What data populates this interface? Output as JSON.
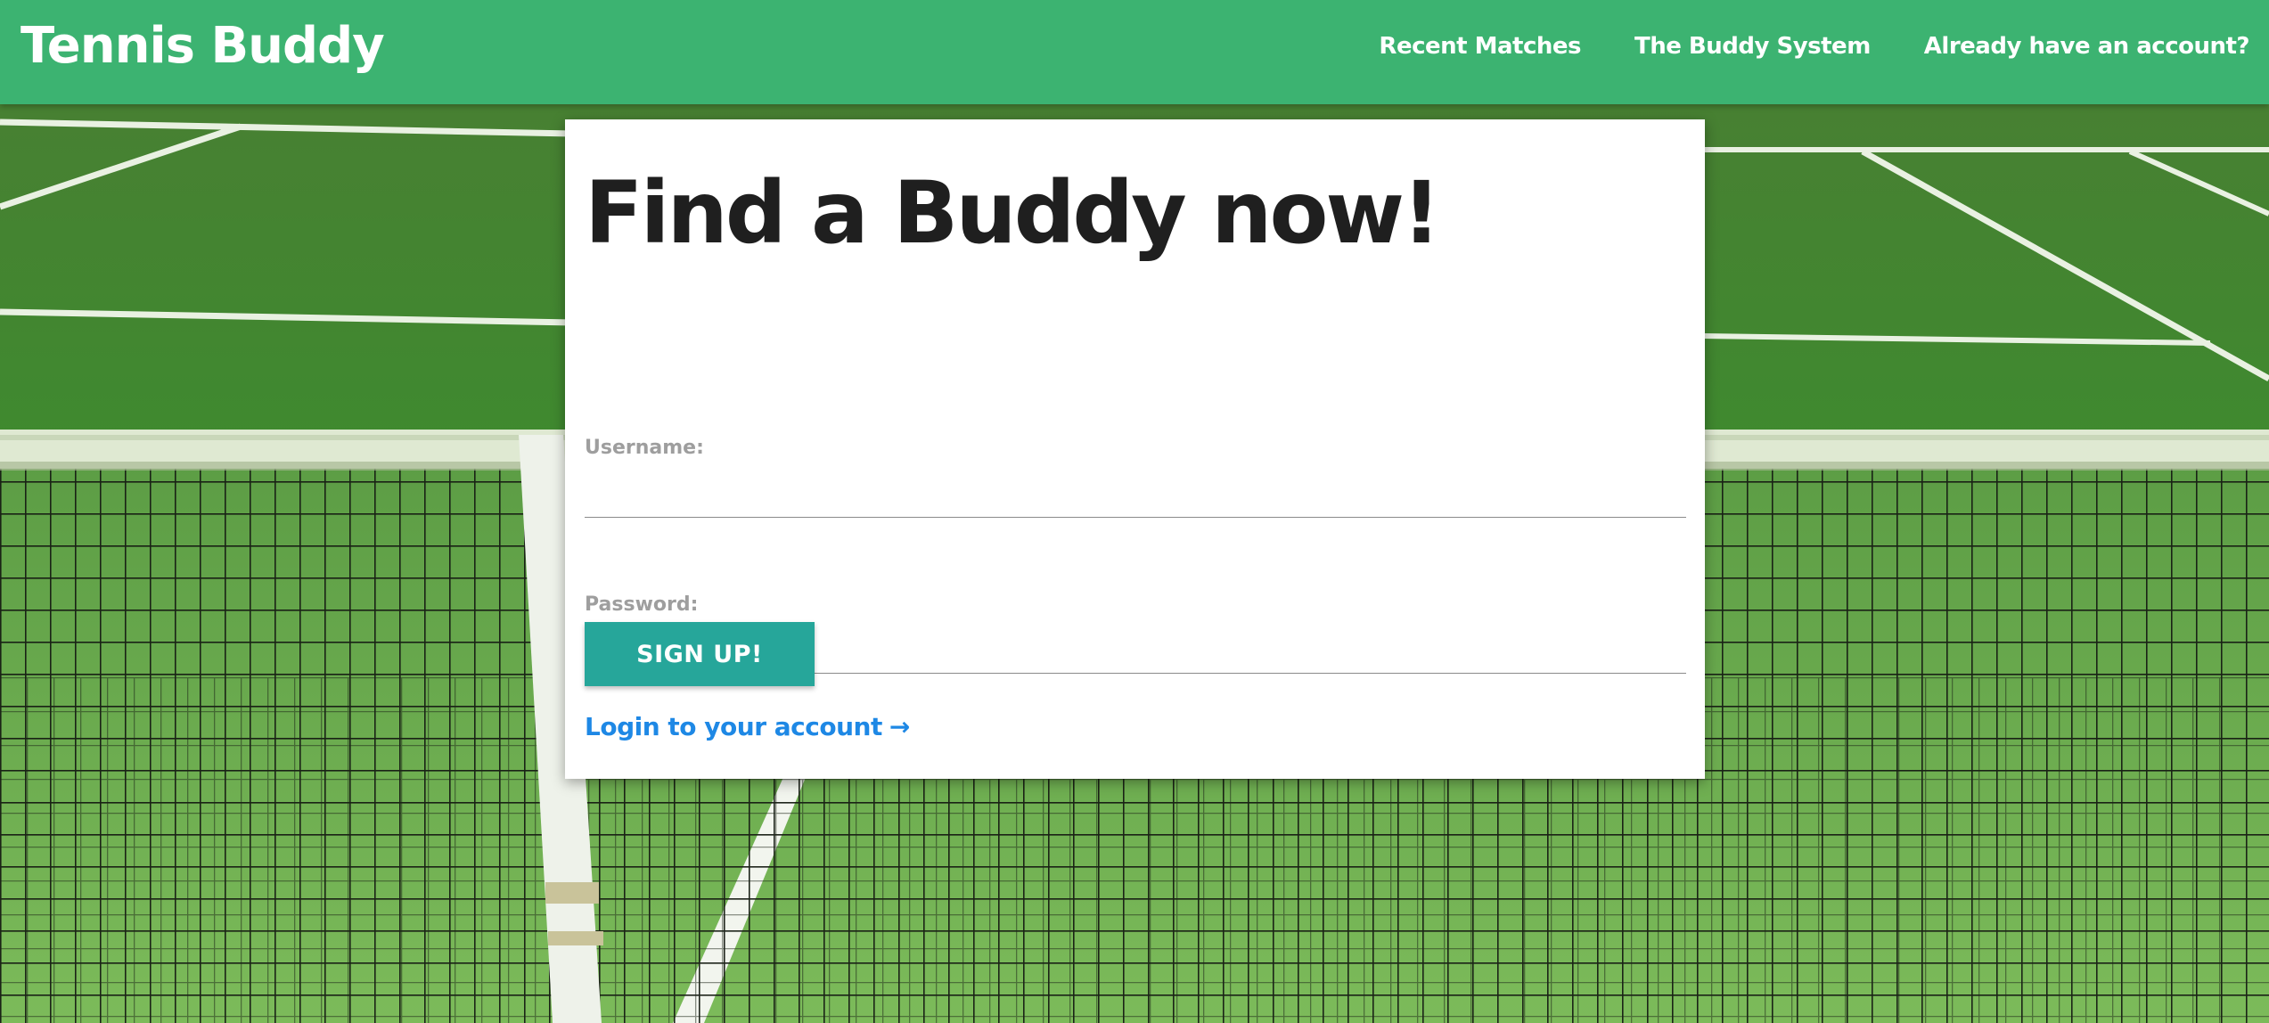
{
  "header": {
    "brand": "Tennis Buddy",
    "nav": [
      {
        "label": "Recent Matches"
      },
      {
        "label": "The Buddy System"
      },
      {
        "label": "Already have an account?"
      }
    ]
  },
  "form": {
    "title": "Find a Buddy now!",
    "username_label": "Username:",
    "username_value": "",
    "password_label": "Password:",
    "password_value": "",
    "submit_label": "SIGN UP!",
    "login_link": "Login to your account",
    "login_arrow": "→"
  },
  "colors": {
    "navbar": "#3cb371",
    "button": "#26a69a",
    "link": "#1e88e5",
    "title": "#1f1f1f",
    "label": "#9e9e9e"
  },
  "icons": {
    "login_arrow": "right-arrow-icon"
  }
}
